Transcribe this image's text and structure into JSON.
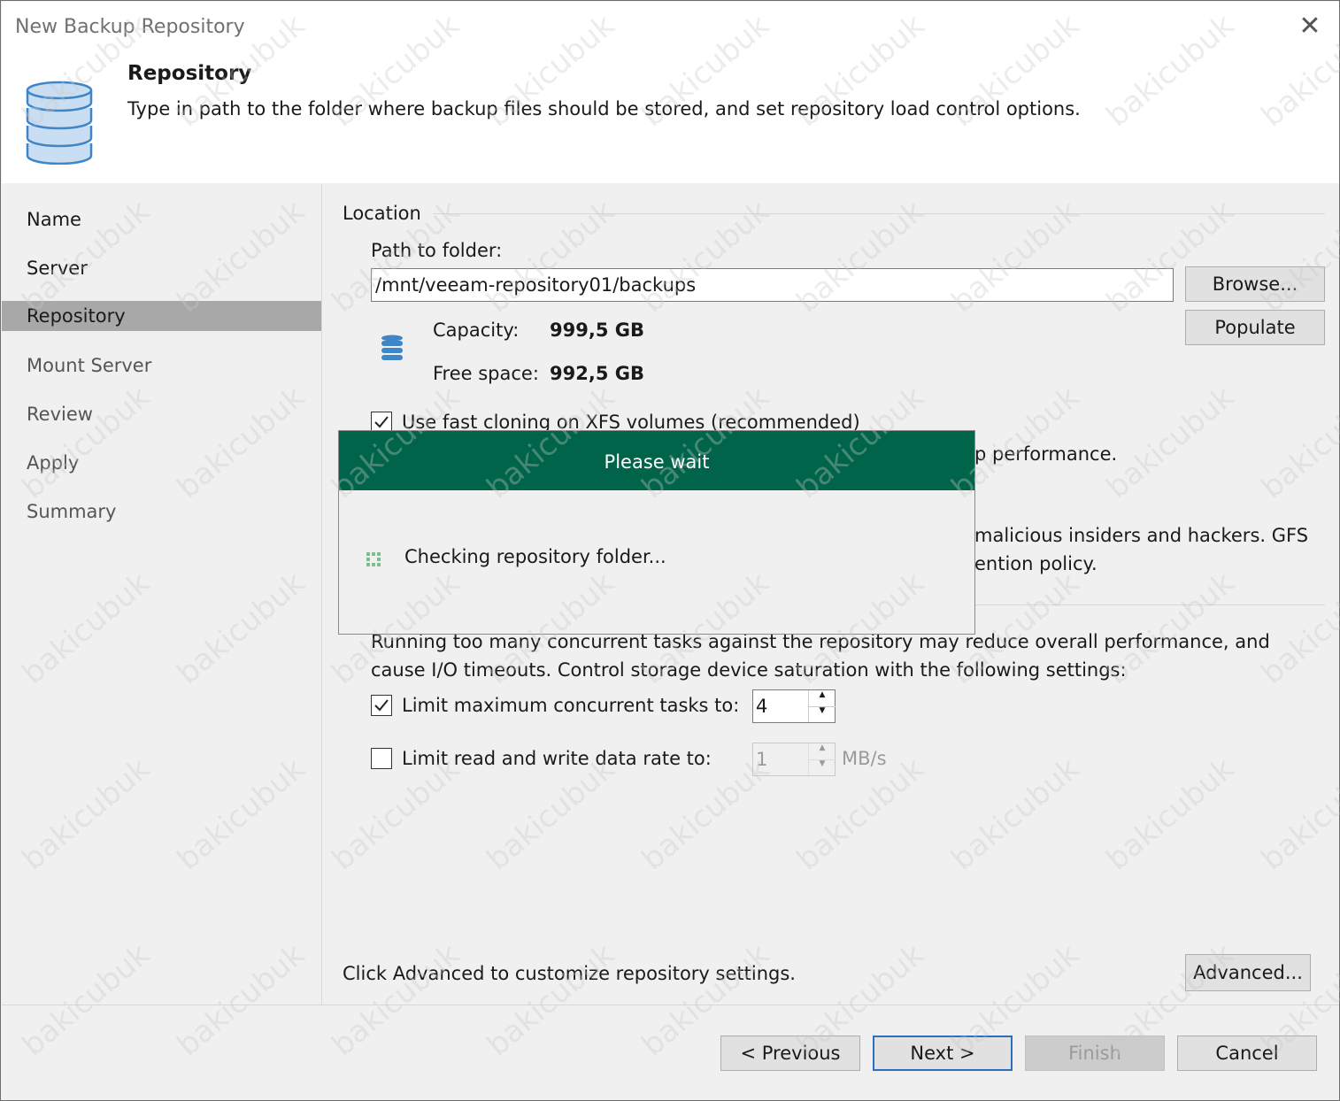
{
  "window": {
    "title": "New Backup Repository",
    "close_glyph": "✕"
  },
  "header": {
    "title": "Repository",
    "description": "Type in path to the folder where backup files should be stored, and set repository load control options.",
    "icon": "database-icon"
  },
  "nav": {
    "items": [
      {
        "label": "Name",
        "state": "done"
      },
      {
        "label": "Server",
        "state": "done"
      },
      {
        "label": "Repository",
        "state": "active"
      },
      {
        "label": "Mount Server",
        "state": "pending"
      },
      {
        "label": "Review",
        "state": "pending"
      },
      {
        "label": "Apply",
        "state": "pending"
      },
      {
        "label": "Summary",
        "state": "pending"
      }
    ]
  },
  "location": {
    "group_label": "Location",
    "path_label": "Path to folder:",
    "path_value": "/mnt/veeam-repository01/backups",
    "browse_label": "Browse...",
    "populate_label": "Populate",
    "capacity_label": "Capacity:",
    "capacity_value": "999,5 GB",
    "free_label": "Free space:",
    "free_value": "992,5 GB",
    "fast_clone_label": "Use fast cloning on XFS volumes (recommended)",
    "fast_clone_checked": true,
    "partial_text_1": "p performance.",
    "partial_text_2": "malicious insiders and hackers. GFS",
    "partial_text_3": "ention policy."
  },
  "load_control": {
    "description_line1": "Running too many concurrent tasks against the repository may reduce overall performance, and",
    "description_line2": "cause I/O timeouts. Control storage device saturation with the following settings:",
    "limit_tasks_label": "Limit maximum concurrent tasks to:",
    "limit_tasks_checked": true,
    "limit_tasks_value": "4",
    "limit_rate_label": "Limit read and write data rate to:",
    "limit_rate_checked": false,
    "limit_rate_value": "1",
    "limit_rate_unit": "MB/s"
  },
  "advanced": {
    "hint": "Click Advanced to customize repository settings.",
    "button_label": "Advanced..."
  },
  "footer": {
    "previous_label": "< Previous",
    "next_label": "Next >",
    "finish_label": "Finish",
    "cancel_label": "Cancel"
  },
  "wait_dialog": {
    "title": "Please wait",
    "message": "Checking repository folder..."
  },
  "colors": {
    "dialog_header": "#00644b",
    "nav_active": "#a8a8a8",
    "default_button_border": "#2b6fc1"
  },
  "watermark": "bakicubuk"
}
